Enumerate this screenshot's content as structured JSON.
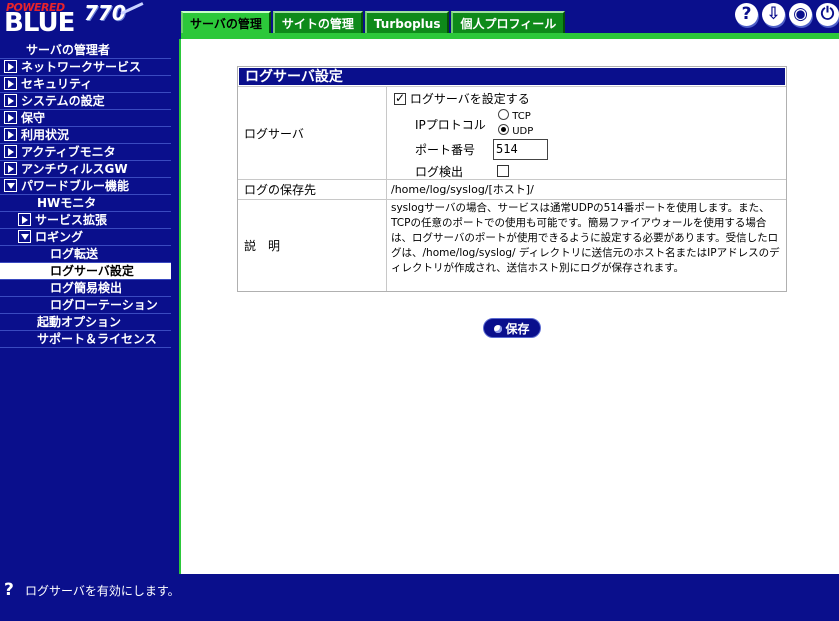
{
  "logo": {
    "powered": "POWERED",
    "brand": "BLUE",
    "model": "770"
  },
  "tabs": [
    {
      "label": "サーバの管理",
      "active": true
    },
    {
      "label": "サイトの管理",
      "active": false
    },
    {
      "label": "Turboplus",
      "active": false
    },
    {
      "label": "個人プロフィール",
      "active": false
    }
  ],
  "top_icons": [
    "help-icon",
    "update-icon",
    "connection-icon",
    "logout-icon"
  ],
  "top_icon_glyphs": {
    "help": "?",
    "update": "⇩",
    "connection": "◉",
    "logout": "⏻"
  },
  "sidebar": {
    "items": [
      {
        "label": "サーバの管理者",
        "icon": "none"
      },
      {
        "label": "ネットワークサービス",
        "icon": "arrow-right"
      },
      {
        "label": "セキュリティ",
        "icon": "arrow-right"
      },
      {
        "label": "システムの設定",
        "icon": "arrow-right"
      },
      {
        "label": "保守",
        "icon": "arrow-right"
      },
      {
        "label": "利用状況",
        "icon": "arrow-right"
      },
      {
        "label": "アクティブモニタ",
        "icon": "arrow-right"
      },
      {
        "label": "アンチウィルスGW",
        "icon": "arrow-right"
      },
      {
        "label": "パワードブルー機能",
        "icon": "arrow-down"
      },
      {
        "label": "HWモニタ",
        "icon": "none"
      },
      {
        "label": "サービス拡張",
        "icon": "arrow-right"
      },
      {
        "label": "ロギング",
        "icon": "arrow-down"
      },
      {
        "label": "ログ転送",
        "icon": "none"
      },
      {
        "label": "ログサーバ設定",
        "icon": "none",
        "selected": true
      },
      {
        "label": "ログ簡易検出",
        "icon": "none"
      },
      {
        "label": "ログローテーション",
        "icon": "none"
      },
      {
        "label": "起動オプション",
        "icon": "none"
      },
      {
        "label": "サポート＆ライセンス",
        "icon": "none"
      }
    ]
  },
  "panel": {
    "title": "ログサーバ設定",
    "log_server": {
      "label": "ログサーバ",
      "enable_label": "ログサーバを設定する",
      "enabled": true,
      "protocol_label": "IPプロトコル",
      "protocol_options": [
        "TCP",
        "UDP"
      ],
      "protocol_selected": "UDP",
      "port_label": "ポート番号",
      "port_value": "514",
      "detect_label": "ログ検出",
      "detect_checked": false
    },
    "save_dir": {
      "label": "ログの保存先",
      "value": "/home/log/syslog/[ホスト]/"
    },
    "description": {
      "label": "説　明",
      "text": "syslogサーバの場合、サービスは通常UDPの514番ポートを使用します。また、TCPの任意のポートでの使用も可能です。簡易ファイアウォールを使用する場合は、ログサーバのポートが使用できるように設定する必要があります。受信したログは、/home/log/syslog/ ディレクトリに送信元のホスト名またはIPアドレスのディレクトリが作成され、送信ホスト別にログが保存されます。"
    },
    "save_label": "保存"
  },
  "status": {
    "help_glyph": "?",
    "message": "ログサーバを有効にします。"
  }
}
